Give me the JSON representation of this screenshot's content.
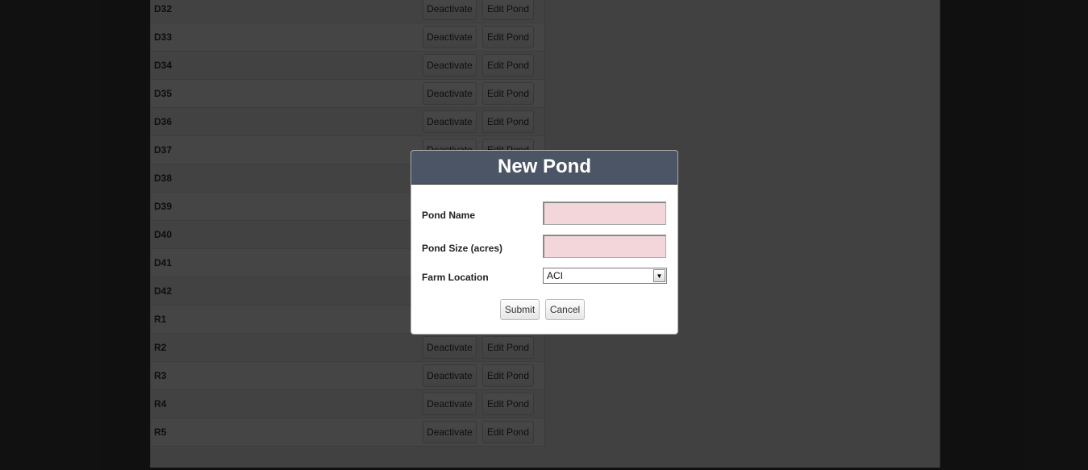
{
  "ponds": [
    {
      "name": "D32"
    },
    {
      "name": "D33"
    },
    {
      "name": "D34"
    },
    {
      "name": "D35"
    },
    {
      "name": "D36"
    },
    {
      "name": "D37"
    },
    {
      "name": "D38"
    },
    {
      "name": "D39"
    },
    {
      "name": "D40"
    },
    {
      "name": "D41"
    },
    {
      "name": "D42"
    },
    {
      "name": "R1"
    },
    {
      "name": "R2"
    },
    {
      "name": "R3"
    },
    {
      "name": "R4"
    },
    {
      "name": "R5"
    }
  ],
  "row_actions": {
    "deactivate_label": "Deactivate",
    "edit_label": "Edit Pond"
  },
  "dialog": {
    "title": "New Pond",
    "pond_name_label": "Pond Name",
    "pond_name_value": "",
    "pond_size_label": "Pond Size (acres)",
    "pond_size_value": "",
    "farm_location_label": "Farm Location",
    "farm_location_selected": "ACI",
    "submit_label": "Submit",
    "cancel_label": "Cancel"
  },
  "colors": {
    "dialog_header": "#4b5566",
    "invalid_input": "#f2d6da"
  }
}
